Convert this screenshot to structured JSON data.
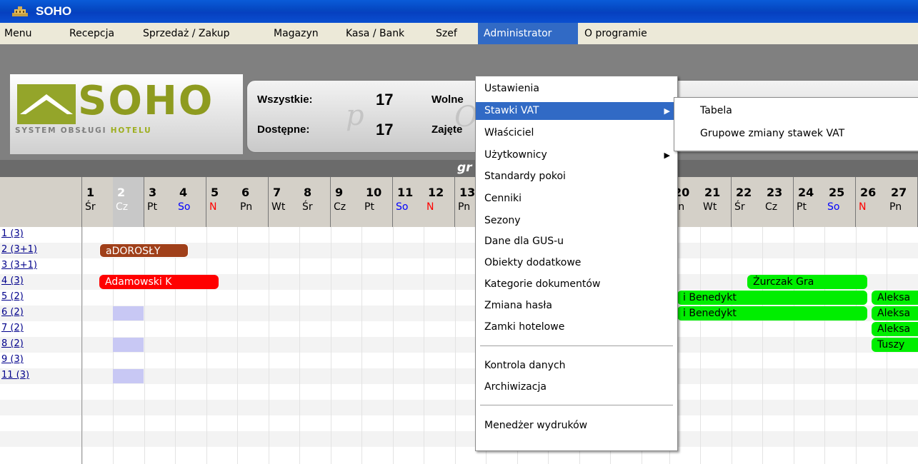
{
  "window": {
    "title": "SOHO"
  },
  "menubar": [
    {
      "label": "Menu"
    },
    {
      "label": "Recepcja"
    },
    {
      "label": "Sprzedaż / Zakup"
    },
    {
      "label": "Magazyn"
    },
    {
      "label": "Kasa / Bank"
    },
    {
      "label": "Szef"
    },
    {
      "label": "Administrator",
      "active": true
    },
    {
      "label": "O programie"
    }
  ],
  "logo": {
    "word": "SOHO",
    "sub_main": "SYSTEM OBSŁUGI ",
    "sub_highlight": "HOTELU"
  },
  "stats": {
    "all_label": "Wszystkie:",
    "all_value": "17",
    "available_label": "Dostępne:",
    "available_value": "17",
    "free_label": "Wolne",
    "occupied_label": "Zajęte",
    "ghost_p": "p",
    "ghost_o": "O"
  },
  "band": {
    "text": "gr"
  },
  "days": [
    {
      "num": "1",
      "name": "Śr"
    },
    {
      "num": "2",
      "name": "Cz"
    },
    {
      "num": "3",
      "name": "Pt"
    },
    {
      "num": "4",
      "name": "So"
    },
    {
      "num": "5",
      "name": "N"
    },
    {
      "num": "6",
      "name": "Pn"
    },
    {
      "num": "7",
      "name": "Wt"
    },
    {
      "num": "8",
      "name": "Śr"
    },
    {
      "num": "9",
      "name": "Cz"
    },
    {
      "num": "10",
      "name": "Pt"
    },
    {
      "num": "11",
      "name": "So"
    },
    {
      "num": "12",
      "name": "N"
    },
    {
      "num": "13",
      "name": "Pn"
    }
  ],
  "days_right": [
    {
      "num": "20",
      "name": "Pn"
    },
    {
      "num": "21",
      "name": "Wt"
    },
    {
      "num": "22",
      "name": "Śr"
    },
    {
      "num": "23",
      "name": "Cz"
    },
    {
      "num": "24",
      "name": "Pt"
    },
    {
      "num": "25",
      "name": "So"
    },
    {
      "num": "26",
      "name": "N"
    },
    {
      "num": "27",
      "name": "Pn"
    }
  ],
  "rooms": [
    "1 (3)",
    "2 (3+1)",
    "3 (3+1)",
    "4 (3)",
    "5 (2)",
    "6 (2)",
    "7 (2)",
    "8 (2)",
    "9 (3)",
    "11 (3)"
  ],
  "bookings": [
    {
      "text": "aDOROSŁY",
      "color": "#a0401a"
    },
    {
      "text": "Adamowski K",
      "color": "#ff0000"
    },
    {
      "text": "Żurczak Gra",
      "color": "#00ee00"
    },
    {
      "text": "i Benedykt",
      "color": "#00ee00"
    },
    {
      "text": "Aleksa",
      "color": "#00ee00"
    },
    {
      "text": "i Benedykt",
      "color": "#00ee00"
    },
    {
      "text": "Aleksa",
      "color": "#00ee00"
    },
    {
      "text": "Aleksa",
      "color": "#00ee00"
    },
    {
      "text": "Tuszy",
      "color": "#00ee00"
    }
  ],
  "admin_menu": [
    {
      "label": "Ustawienia"
    },
    {
      "label": "Stawki VAT",
      "submenu": true,
      "highlight": true
    },
    {
      "label": "Właściciel"
    },
    {
      "label": "Użytkownicy",
      "submenu": true
    },
    {
      "label": "Standardy  pokoi"
    },
    {
      "label": "Cenniki"
    },
    {
      "label": "Sezony"
    },
    {
      "label": "Dane dla GUS-u"
    },
    {
      "label": "Obiekty dodatkowe"
    },
    {
      "label": "Kategorie dokumentów"
    },
    {
      "label": "Zmiana hasła"
    },
    {
      "label": "Zamki hotelowe"
    },
    {
      "label": "Kontrola danych"
    },
    {
      "label": "Archiwizacja"
    },
    {
      "label": "Menedżer wydruków"
    }
  ],
  "vat_submenu": [
    {
      "label": "Tabela"
    },
    {
      "label": "Grupowe zmiany stawek VAT"
    }
  ],
  "colors": {
    "titlebar": "#0546c0",
    "menu_highlight": "#316ac5",
    "weekend_sat": "#0000ff",
    "weekend_sun": "#ff0000",
    "logo": "#8e9b1f"
  }
}
